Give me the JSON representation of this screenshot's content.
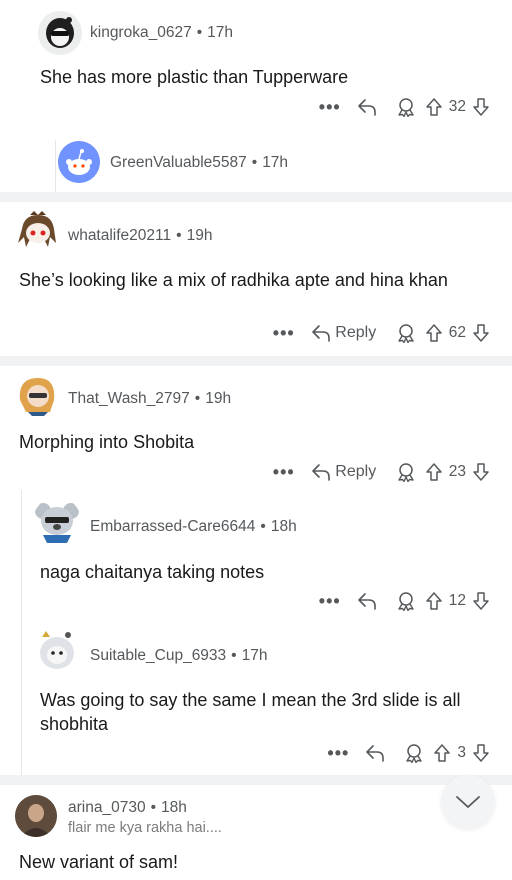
{
  "comments": [
    {
      "user": "kingroka_0627",
      "time": "17h",
      "body": "She has more plastic than Tupperware",
      "votes": "32",
      "reply_label": ""
    },
    {
      "user": "GreenValuable5587",
      "time": "17h",
      "body": "",
      "votes": "",
      "reply_label": ""
    },
    {
      "user": "whatalife20211",
      "time": "19h",
      "body": "She’s looking like a mix of radhika apte and hina khan",
      "votes": "62",
      "reply_label": "Reply"
    },
    {
      "user": "That_Wash_2797",
      "time": "19h",
      "body": "Morphing into Shobita",
      "votes": "23",
      "reply_label": "Reply"
    },
    {
      "user": "Embarrassed-Care6644",
      "time": "18h",
      "body": "naga chaitanya taking notes",
      "votes": "12",
      "reply_label": ""
    },
    {
      "user": "Suitable_Cup_6933",
      "time": "17h",
      "body": "Was going to say the same I mean the 3rd slide is all shobhita",
      "votes": "3",
      "reply_label": ""
    },
    {
      "user": "arina_0730",
      "time": "18h",
      "flair": "flair me kya rakha hai....",
      "body": "New variant of sam!"
    }
  ],
  "sep": "•",
  "more_glyph": "•••",
  "icons": {
    "more": "more-options-icon",
    "reply": "reply-arrow-icon",
    "award": "award-icon",
    "upvote": "upvote-arrow-icon",
    "downvote": "downvote-arrow-icon",
    "scroll": "chevron-down-icon"
  },
  "colors": {
    "meta": "#55595c",
    "text": "#1a1a1b",
    "divider": "#f1f2f3",
    "thread": "#e5e7e8",
    "greenvaluable_avatar": "#7193ff"
  }
}
